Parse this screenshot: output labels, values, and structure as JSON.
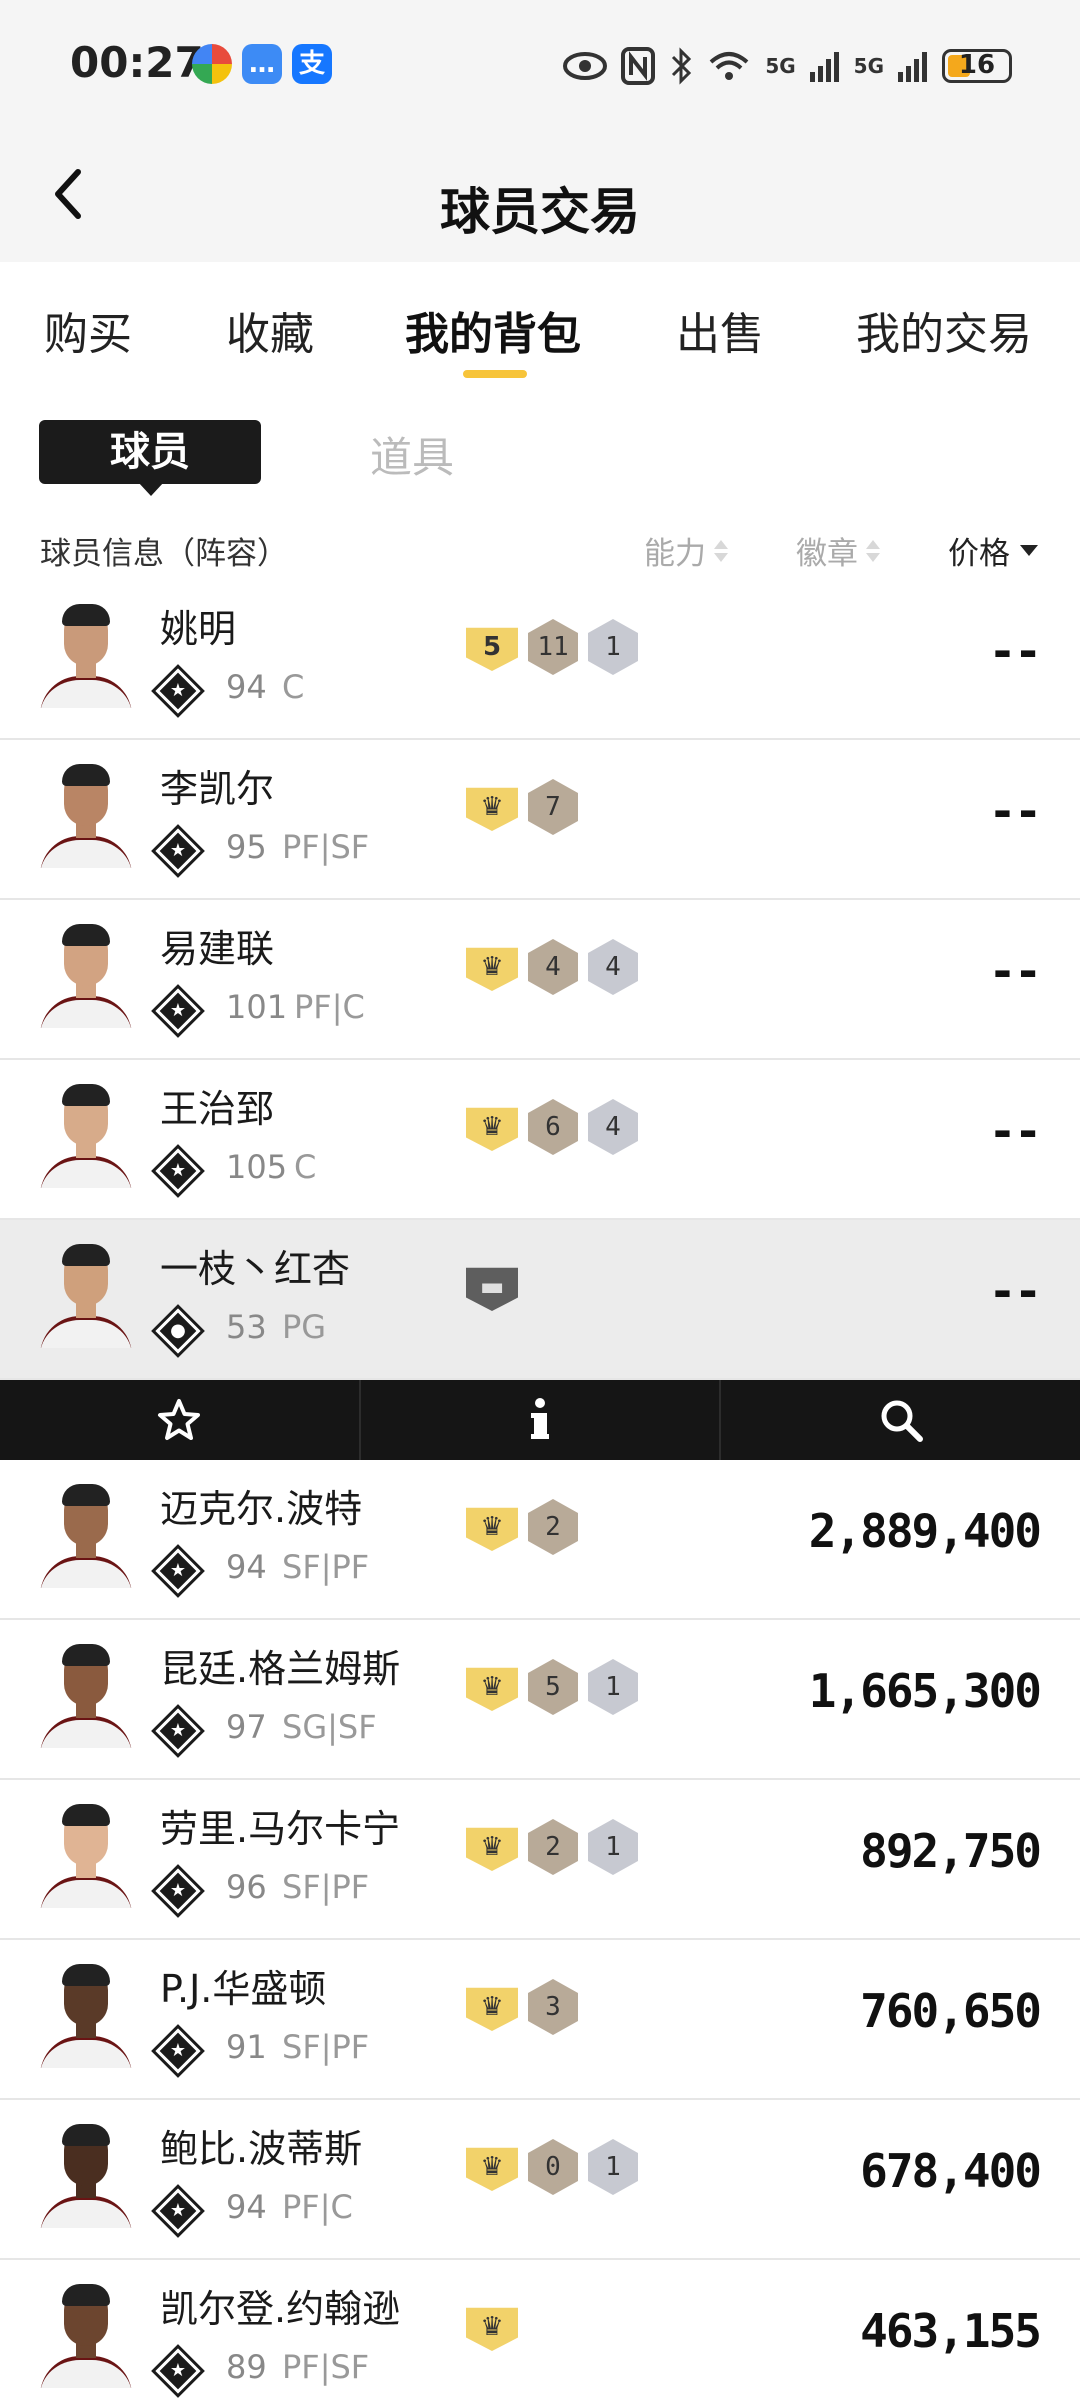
{
  "status_bar": {
    "time": "00:27",
    "apps": [
      "colorful-app-icon",
      "messages-icon",
      "alipay-icon"
    ],
    "alipay_label": "支",
    "signals": [
      "5G",
      "5G"
    ],
    "battery": "16",
    "battery_color": "#f4a81c"
  },
  "header": {
    "title": "球员交易",
    "back_icon": "chevron-left-icon"
  },
  "tabs": [
    {
      "label": "购买",
      "active": false
    },
    {
      "label": "收藏",
      "active": false
    },
    {
      "label": "我的背包",
      "active": true
    },
    {
      "label": "出售",
      "active": false
    },
    {
      "label": "我的交易",
      "active": false
    }
  ],
  "accent_color": "#f7c43a",
  "segments": {
    "active": "球员",
    "inactive": "道具"
  },
  "columns": {
    "info": "球员信息（阵容）",
    "ability": "能力",
    "badges": "徽章",
    "price": "价格"
  },
  "players": [
    {
      "name": "姚明",
      "ovr": "94",
      "pos": "C",
      "level": "5",
      "hof": "11",
      "gold": "1",
      "price": "--"
    },
    {
      "name": "李凯尔",
      "ovr": "95",
      "pos": "PF|SF",
      "level": "crown",
      "hof": "7",
      "gold": "",
      "price": "--"
    },
    {
      "name": "易建联",
      "ovr": "101",
      "pos": "PF|C",
      "level": "crown",
      "hof": "4",
      "gold": "4",
      "price": "--"
    },
    {
      "name": "王治郅",
      "ovr": "105",
      "pos": "C",
      "level": "crown",
      "hof": "6",
      "gold": "4",
      "price": "--"
    },
    {
      "name": "一枝丶红杏",
      "ovr": "53",
      "pos": "PG",
      "level": "none",
      "hof": "",
      "gold": "",
      "price": "--",
      "selected": true
    }
  ],
  "action_bar": [
    "star-icon",
    "info-icon",
    "search-icon"
  ],
  "market_players": [
    {
      "name": "迈克尔.波特",
      "ovr": "94",
      "pos": "SF|PF",
      "level": "crown",
      "hof": "2",
      "gold": "",
      "price": "2,889,400"
    },
    {
      "name": "昆廷.格兰姆斯",
      "ovr": "97",
      "pos": "SG|SF",
      "level": "crown",
      "hof": "5",
      "gold": "1",
      "price": "1,665,300"
    },
    {
      "name": "劳里.马尔卡宁",
      "ovr": "96",
      "pos": "SF|PF",
      "level": "crown",
      "hof": "2",
      "gold": "1",
      "price": "892,750"
    },
    {
      "name": "P.J.华盛顿",
      "ovr": "91",
      "pos": "SF|PF",
      "level": "crown",
      "hof": "3",
      "gold": "",
      "price": "760,650"
    },
    {
      "name": "鲍比.波蒂斯",
      "ovr": "94",
      "pos": "PF|C",
      "level": "crown",
      "hof": "0",
      "gold": "1",
      "price": "678,400"
    },
    {
      "name": "凯尔登.约翰逊",
      "ovr": "89",
      "pos": "PF|SF",
      "level": "crown",
      "hof": "",
      "gold": "",
      "price": "463,155"
    }
  ]
}
